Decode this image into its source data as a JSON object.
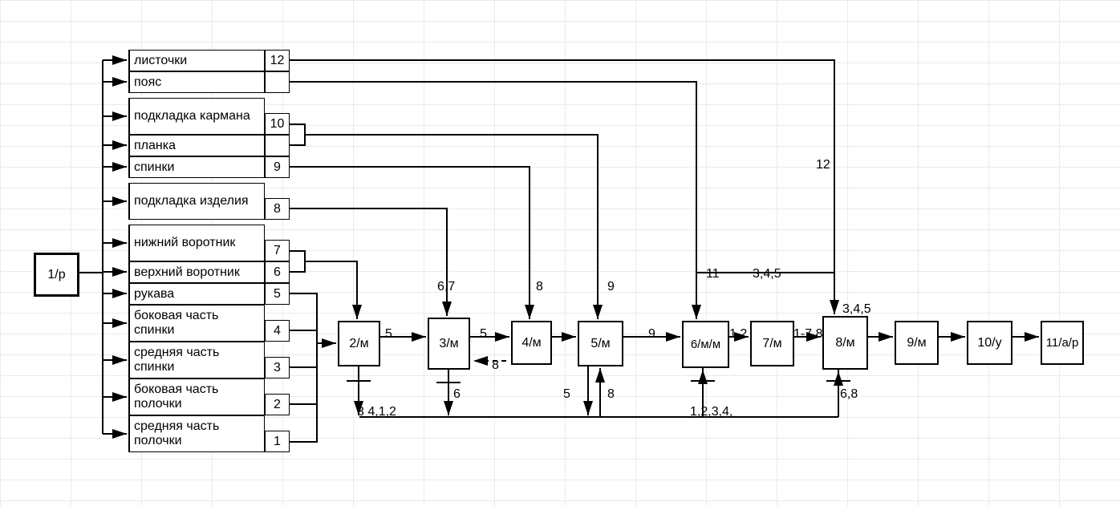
{
  "source": {
    "label": "1/p"
  },
  "items": [
    {
      "name": "листочки",
      "num": "12"
    },
    {
      "name": "пояс",
      "num": ""
    },
    {
      "name": "подкладка кармана",
      "num": "10"
    },
    {
      "name": "планка",
      "num": ""
    },
    {
      "name": "спинки",
      "num": "9"
    },
    {
      "name": "подкладка изделия",
      "num": "8"
    },
    {
      "name": "нижний воротник",
      "num": "7"
    },
    {
      "name": "верхний воротник",
      "num": "6"
    },
    {
      "name": "рукава",
      "num": "5"
    },
    {
      "name": "боковая часть спинки",
      "num": "4"
    },
    {
      "name": "средняя часть спинки",
      "num": "3"
    },
    {
      "name": "боковая часть полочки",
      "num": "2"
    },
    {
      "name": "средняя часть полочки",
      "num": "1"
    }
  ],
  "ops": [
    {
      "label": "2/м"
    },
    {
      "label": "3/м"
    },
    {
      "label": "4/м"
    },
    {
      "label": "5/м"
    },
    {
      "label": "6/м/м"
    },
    {
      "label": "7/м"
    },
    {
      "label": "8/м"
    },
    {
      "label": "9/м"
    },
    {
      "label": "10/у"
    },
    {
      "label": "11/а/р"
    }
  ],
  "edge_labels": {
    "l_5a": "5",
    "l_5b": "5",
    "l_67": "6,7",
    "l_8a": "8",
    "l_9a": "9",
    "l_9b": "9",
    "l_11": "11",
    "l_345a": "3,4,5",
    "l_345b": "3,4,5",
    "l_12": "12",
    "l_12b": "1,2",
    "l_178": "1-7,8",
    "l_3412": "3 4,1,2",
    "l_6": "6",
    "l_5c": "5",
    "l_8b": "8",
    "l_12345": "1,2,3,4,",
    "l_68": "6,8",
    "l_m8": "8"
  }
}
